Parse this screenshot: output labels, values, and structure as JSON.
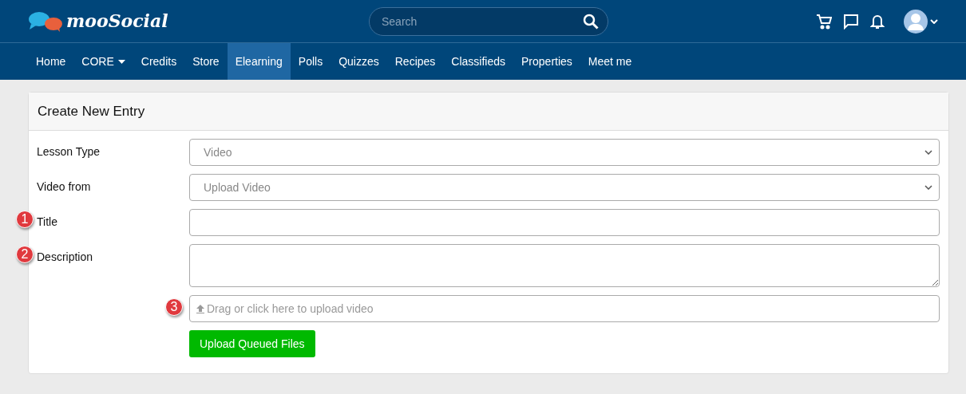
{
  "header": {
    "logo": "mooSocial",
    "search": {
      "placeholder": "Search"
    }
  },
  "nav": [
    {
      "label": "Home",
      "selected": false
    },
    {
      "label": "CORE",
      "selected": false,
      "dropdown": true
    },
    {
      "label": "Credits",
      "selected": false
    },
    {
      "label": "Store",
      "selected": false
    },
    {
      "label": "Elearning",
      "selected": true
    },
    {
      "label": "Polls",
      "selected": false
    },
    {
      "label": "Quizzes",
      "selected": false
    },
    {
      "label": "Recipes",
      "selected": false
    },
    {
      "label": "Classifieds",
      "selected": false
    },
    {
      "label": "Properties",
      "selected": false
    },
    {
      "label": "Meet me",
      "selected": false
    }
  ],
  "card": {
    "title": "Create New Entry",
    "rows": [
      {
        "kind": "select",
        "label": "Lesson Type",
        "value": "Video"
      },
      {
        "kind": "select",
        "label": "Video from",
        "value": "Upload Video"
      },
      {
        "kind": "input",
        "label": "Title",
        "marker": "1"
      },
      {
        "kind": "textarea",
        "label": "Description",
        "marker": "2"
      },
      {
        "kind": "upload",
        "marker": "3",
        "placeholder": "Drag or click here to upload video"
      },
      {
        "kind": "button",
        "text": "Upload Queued Files"
      }
    ]
  }
}
